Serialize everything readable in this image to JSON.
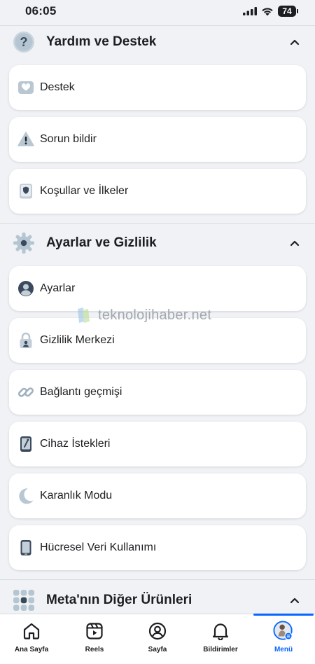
{
  "status_bar": {
    "time": "06:05",
    "battery": "74"
  },
  "sections": {
    "help": {
      "title": "Yardım ve Destek",
      "items": [
        {
          "label": "Destek",
          "icon": "support-inbox-icon"
        },
        {
          "label": "Sorun bildir",
          "icon": "warning-icon"
        },
        {
          "label": "Koşullar ve İlkeler",
          "icon": "policy-book-icon"
        }
      ]
    },
    "settings": {
      "title": "Ayarlar ve Gizlilik",
      "items": [
        {
          "label": "Ayarlar",
          "icon": "account-settings-icon"
        },
        {
          "label": "Gizlilik Merkezi",
          "icon": "lock-icon"
        },
        {
          "label": "Bağlantı geçmişi",
          "icon": "link-icon"
        },
        {
          "label": "Cihaz İstekleri",
          "icon": "device-icon"
        },
        {
          "label": "Karanlık Modu",
          "icon": "moon-icon"
        },
        {
          "label": "Hücresel Veri Kullanımı",
          "icon": "phone-icon"
        }
      ]
    },
    "meta": {
      "title": "Meta'nın Diğer Ürünleri"
    }
  },
  "watermark": "teknolojihaber.net",
  "tabs": [
    {
      "label": "Ana Sayfa",
      "icon": "home-icon"
    },
    {
      "label": "Reels",
      "icon": "reels-icon"
    },
    {
      "label": "Sayfa",
      "icon": "profile-icon"
    },
    {
      "label": "Bildirimler",
      "icon": "bell-icon"
    },
    {
      "label": "Menü",
      "icon": "menu-avatar-icon",
      "active": true
    }
  ],
  "colors": {
    "accent": "#0866ff",
    "background": "#f0f2f5",
    "card": "#ffffff"
  }
}
